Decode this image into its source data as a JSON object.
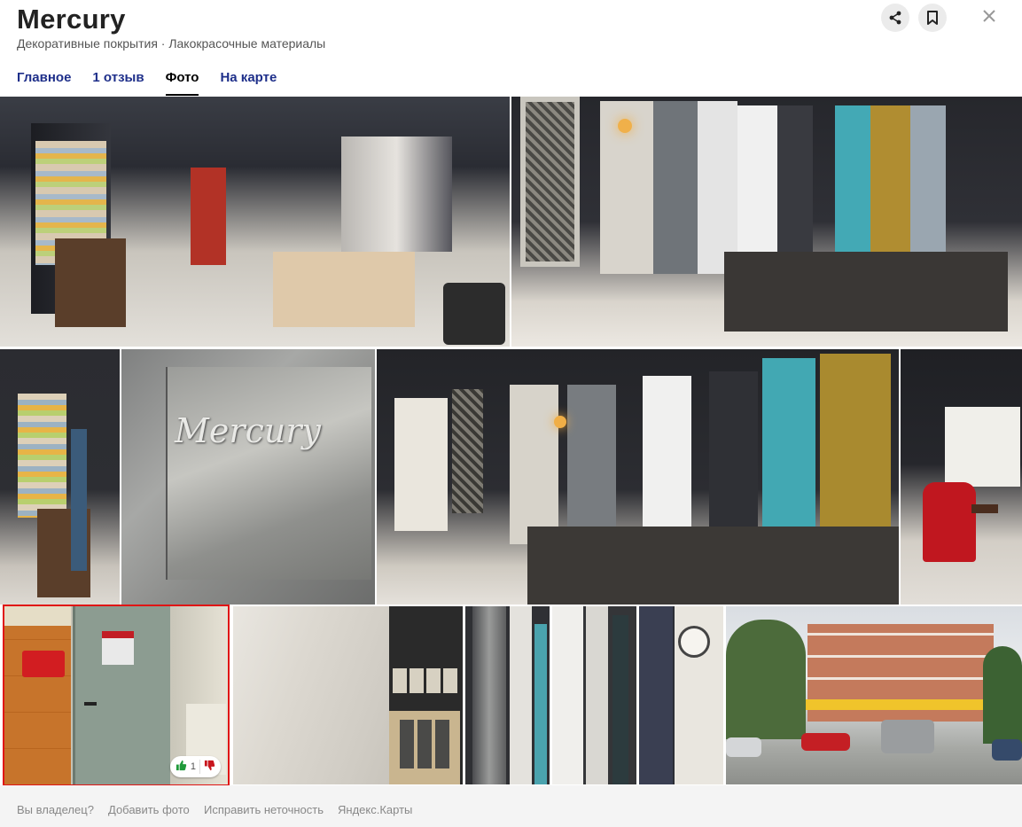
{
  "header": {
    "title": "Mercury",
    "subtitle": "Декоративные покрытия · Лакокрасочные материалы",
    "share_icon": "share-icon",
    "bookmark_icon": "bookmark-icon",
    "close_icon": "close-icon"
  },
  "tabs": [
    {
      "label": "Главное",
      "active": false
    },
    {
      "label": "1 отзыв",
      "active": false
    },
    {
      "label": "Фото",
      "active": true
    },
    {
      "label": "На карте",
      "active": false
    }
  ],
  "photos": {
    "selected": {
      "likes": "1",
      "like_icon": "thumbs-up-icon",
      "dislike_icon": "thumbs-down-icon",
      "sign_text": "Mercury",
      "highlight_color": "#e01515"
    }
  },
  "footer": {
    "links": [
      "Вы владелец?",
      "Добавить фото",
      "Исправить неточность",
      "Яндекс.Карты"
    ]
  },
  "colors": {
    "tab_link": "#1e2f8a",
    "selection": "#e01515",
    "footer_bg": "#f4f4f4"
  }
}
